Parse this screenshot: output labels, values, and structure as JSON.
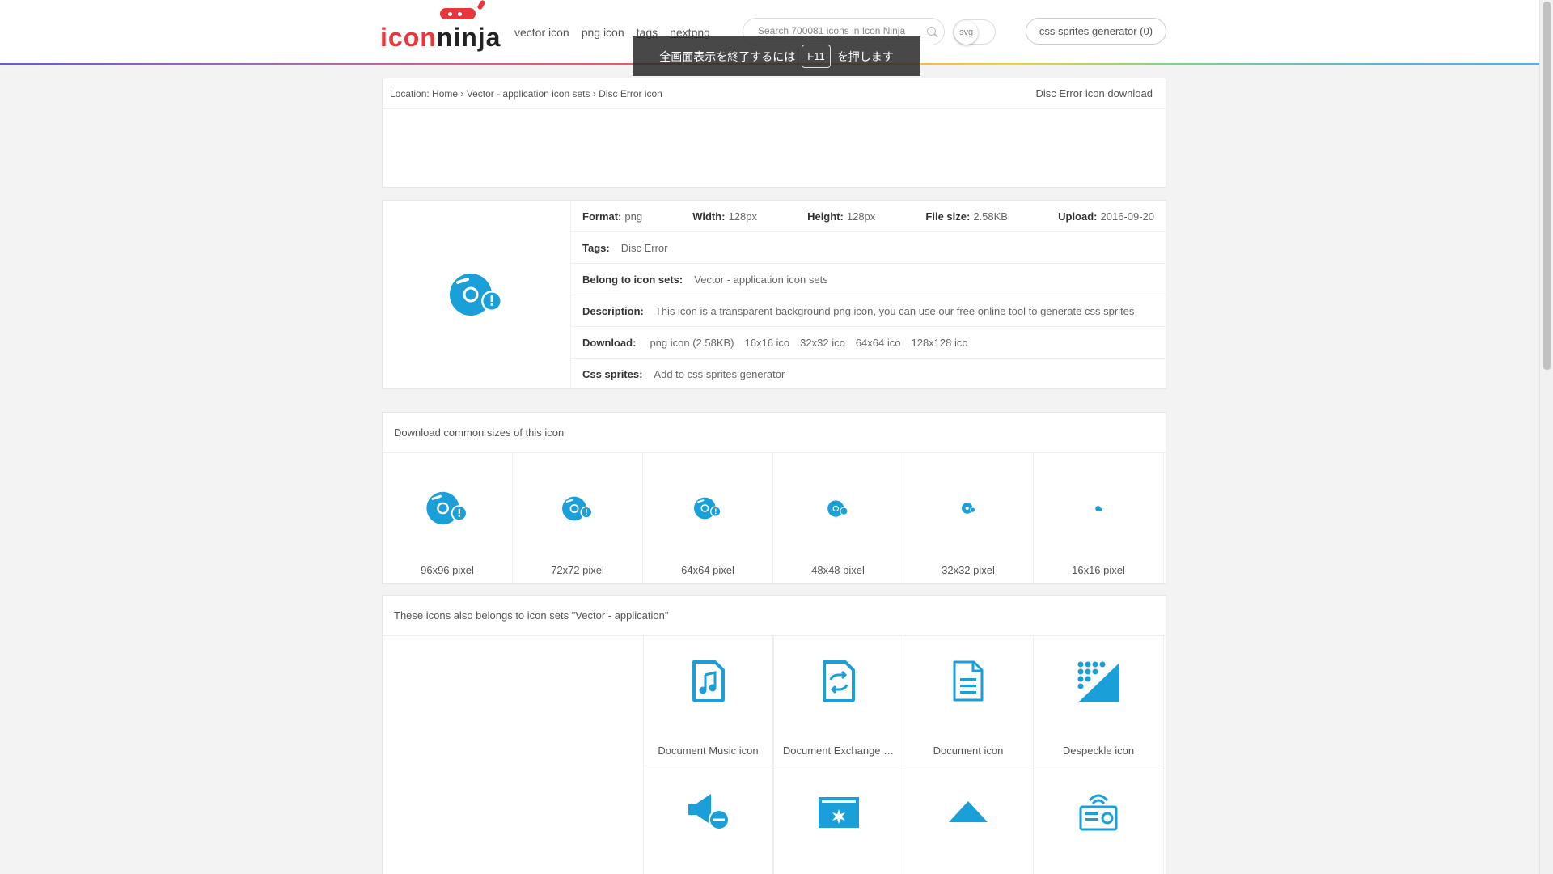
{
  "header": {
    "logo": {
      "part1": "icon",
      "part2": "ninja"
    },
    "nav": [
      "vector icon",
      "png icon",
      "tags",
      "nextpng"
    ],
    "search": {
      "placeholder": "Search 700081 icons in Icon Ninja"
    },
    "svg_toggle_label": "svg",
    "css_sprites_button": "css sprites generator (0)"
  },
  "fullscreen_notice": {
    "before": "全画面表示を終了するには",
    "key": "F11",
    "after": "を押します"
  },
  "location": {
    "label": "Location:",
    "crumbs": [
      "Home",
      "Vector - application icon sets",
      "Disc Error icon"
    ],
    "right_title": "Disc Error icon download"
  },
  "details": {
    "format": {
      "label": "Format:",
      "value": "png"
    },
    "width": {
      "label": "Width:",
      "value": "128px"
    },
    "height": {
      "label": "Height:",
      "value": "128px"
    },
    "file_size": {
      "label": "File size:",
      "value": "2.58KB"
    },
    "upload": {
      "label": "Upload:",
      "value": "2016-09-20"
    },
    "tags": {
      "label": "Tags:",
      "value": "Disc Error"
    },
    "icon_sets": {
      "label": "Belong to icon sets:",
      "value": "Vector - application icon sets"
    },
    "description": {
      "label": "Description:",
      "value": "This icon is a transparent background png icon, you can use our free online tool to generate css sprites"
    },
    "download": {
      "label": "Download:",
      "links": [
        "png icon (2.58KB)",
        "16x16 ico",
        "32x32 ico",
        "64x64 ico",
        "128x128 ico"
      ]
    },
    "css_sprites": {
      "label": "Css sprites:",
      "value": "Add to css sprites generator"
    }
  },
  "common_sizes": {
    "title": "Download common sizes of this icon",
    "sizes": [
      "96x96 pixel",
      "72x72 pixel",
      "64x64 pixel",
      "48x48 pixel",
      "32x32 pixel",
      "16x16 pixel"
    ]
  },
  "related": {
    "title": "These icons also belongs to icon sets \"Vector - application\"",
    "items": [
      "Document Music icon",
      "Document Exchange …",
      "Document icon",
      "Despeckle icon"
    ]
  },
  "colors": {
    "accent": "#1a9fd8",
    "logo_red": "#e8363c"
  },
  "icons": [
    "disc-error-icon",
    "document-music-icon",
    "document-exchange-icon",
    "document-icon",
    "despeckle-icon",
    "speaker-minus-icon",
    "folder-burst-icon",
    "triangle-up-icon",
    "radio-icon"
  ]
}
